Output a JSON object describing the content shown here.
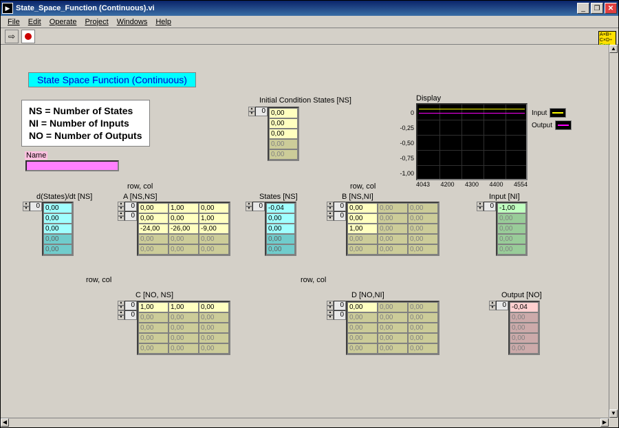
{
  "window_title": "State_Space_Function (Continuous).vi",
  "menus": [
    "File",
    "Edit",
    "Operate",
    "Project",
    "Windows",
    "Help"
  ],
  "icon_cluster": [
    "A×B÷",
    "C×D÷",
    "Cont"
  ],
  "banner": "State Space Function (Continuous)",
  "definitions": [
    "NS = Number of States",
    "NI = Number of Inputs",
    "NO = Number of Outputs"
  ],
  "name_label": "Name",
  "labels": {
    "init_cond": "Initial Condition States [NS]",
    "dstates": "d(States)/dt [NS]",
    "rowcol_a": "row, col",
    "a": "A [NS,NS]",
    "states": "States [NS]",
    "rowcol_b": "row, col",
    "b": "B [NS,NI]",
    "input": "Input [NI]",
    "rowcol_c": "row, col",
    "c": "C [NO, NS]",
    "rowcol_d": "row, col",
    "d": "D [NO,NI]",
    "output": "Output [NO]",
    "display": "Display"
  },
  "init_cond": {
    "idx": "0",
    "active": [
      "0,00",
      "0,00",
      "0,00"
    ],
    "dim": [
      "0,00",
      "0,00"
    ]
  },
  "dstates": {
    "idx": "0",
    "active": [
      "0,00",
      "0,00",
      "0,00"
    ],
    "dim": [
      "0,00",
      "0,00"
    ]
  },
  "states": {
    "idx": "0",
    "active": [
      "-0,04",
      "0,00",
      "0,00"
    ],
    "dim": [
      "0,00",
      "0,00"
    ]
  },
  "input": {
    "idx": "0",
    "active": [
      "-1,00"
    ],
    "dim": [
      "0,00",
      "0,00",
      "0,00",
      "0,00"
    ]
  },
  "output": {
    "idx": "0",
    "active": [
      "-0,04"
    ],
    "dim": [
      "0,00",
      "0,00",
      "0,00",
      "0,00"
    ]
  },
  "matrix_a": {
    "idx_r": "0",
    "idx_c": "0",
    "rows": [
      [
        {
          "v": "0,00",
          "a": 1
        },
        {
          "v": "1,00",
          "a": 1
        },
        {
          "v": "0,00",
          "a": 1
        }
      ],
      [
        {
          "v": "0,00",
          "a": 1
        },
        {
          "v": "0,00",
          "a": 1
        },
        {
          "v": "1,00",
          "a": 1
        }
      ],
      [
        {
          "v": "-24,00",
          "a": 1
        },
        {
          "v": "-26,00",
          "a": 1
        },
        {
          "v": "-9,00",
          "a": 1
        }
      ],
      [
        {
          "v": "0,00",
          "a": 0
        },
        {
          "v": "0,00",
          "a": 0
        },
        {
          "v": "0,00",
          "a": 0
        }
      ],
      [
        {
          "v": "0,00",
          "a": 0
        },
        {
          "v": "0,00",
          "a": 0
        },
        {
          "v": "0,00",
          "a": 0
        }
      ]
    ]
  },
  "matrix_b": {
    "idx_r": "0",
    "idx_c": "0",
    "rows": [
      [
        {
          "v": "0,00",
          "a": 1
        },
        {
          "v": "0,00",
          "a": 0
        },
        {
          "v": "0,00",
          "a": 0
        }
      ],
      [
        {
          "v": "0,00",
          "a": 1
        },
        {
          "v": "0,00",
          "a": 0
        },
        {
          "v": "0,00",
          "a": 0
        }
      ],
      [
        {
          "v": "1,00",
          "a": 1
        },
        {
          "v": "0,00",
          "a": 0
        },
        {
          "v": "0,00",
          "a": 0
        }
      ],
      [
        {
          "v": "0,00",
          "a": 0
        },
        {
          "v": "0,00",
          "a": 0
        },
        {
          "v": "0,00",
          "a": 0
        }
      ],
      [
        {
          "v": "0,00",
          "a": 0
        },
        {
          "v": "0,00",
          "a": 0
        },
        {
          "v": "0,00",
          "a": 0
        }
      ]
    ]
  },
  "matrix_c": {
    "idx_r": "0",
    "idx_c": "0",
    "rows": [
      [
        {
          "v": "1,00",
          "a": 1
        },
        {
          "v": "1,00",
          "a": 1
        },
        {
          "v": "0,00",
          "a": 1
        }
      ],
      [
        {
          "v": "0,00",
          "a": 0
        },
        {
          "v": "0,00",
          "a": 0
        },
        {
          "v": "0,00",
          "a": 0
        }
      ],
      [
        {
          "v": "0,00",
          "a": 0
        },
        {
          "v": "0,00",
          "a": 0
        },
        {
          "v": "0,00",
          "a": 0
        }
      ],
      [
        {
          "v": "0,00",
          "a": 0
        },
        {
          "v": "0,00",
          "a": 0
        },
        {
          "v": "0,00",
          "a": 0
        }
      ],
      [
        {
          "v": "0,00",
          "a": 0
        },
        {
          "v": "0,00",
          "a": 0
        },
        {
          "v": "0,00",
          "a": 0
        }
      ]
    ]
  },
  "matrix_d": {
    "idx_r": "0",
    "idx_c": "0",
    "rows": [
      [
        {
          "v": "0,00",
          "a": 1
        },
        {
          "v": "0,00",
          "a": 0
        },
        {
          "v": "0,00",
          "a": 0
        }
      ],
      [
        {
          "v": "0,00",
          "a": 0
        },
        {
          "v": "0,00",
          "a": 0
        },
        {
          "v": "0,00",
          "a": 0
        }
      ],
      [
        {
          "v": "0,00",
          "a": 0
        },
        {
          "v": "0,00",
          "a": 0
        },
        {
          "v": "0,00",
          "a": 0
        }
      ],
      [
        {
          "v": "0,00",
          "a": 0
        },
        {
          "v": "0,00",
          "a": 0
        },
        {
          "v": "0,00",
          "a": 0
        }
      ],
      [
        {
          "v": "0,00",
          "a": 0
        },
        {
          "v": "0,00",
          "a": 0
        },
        {
          "v": "0,00",
          "a": 0
        }
      ]
    ]
  },
  "chart_data": {
    "type": "line",
    "title": "Display",
    "xlabel": "",
    "ylabel": "",
    "ylim": [
      -1.0,
      0.0
    ],
    "yticks": [
      "0",
      "-0,25",
      "-0,50",
      "-0,75",
      "-1,00"
    ],
    "xticks": [
      "4043",
      "4200",
      "4300",
      "4400",
      "4554"
    ],
    "series": [
      {
        "name": "Input",
        "color": "#ffff00",
        "values": [
          0,
          0,
          0,
          0,
          0
        ]
      },
      {
        "name": "Output",
        "color": "#ff00ff",
        "values": [
          -0.04,
          -0.04,
          -0.04,
          -0.04,
          -0.04
        ]
      }
    ]
  },
  "legend": [
    {
      "label": "Input",
      "color": "#ffff00"
    },
    {
      "label": "Output",
      "color": "#ff00ff"
    }
  ]
}
